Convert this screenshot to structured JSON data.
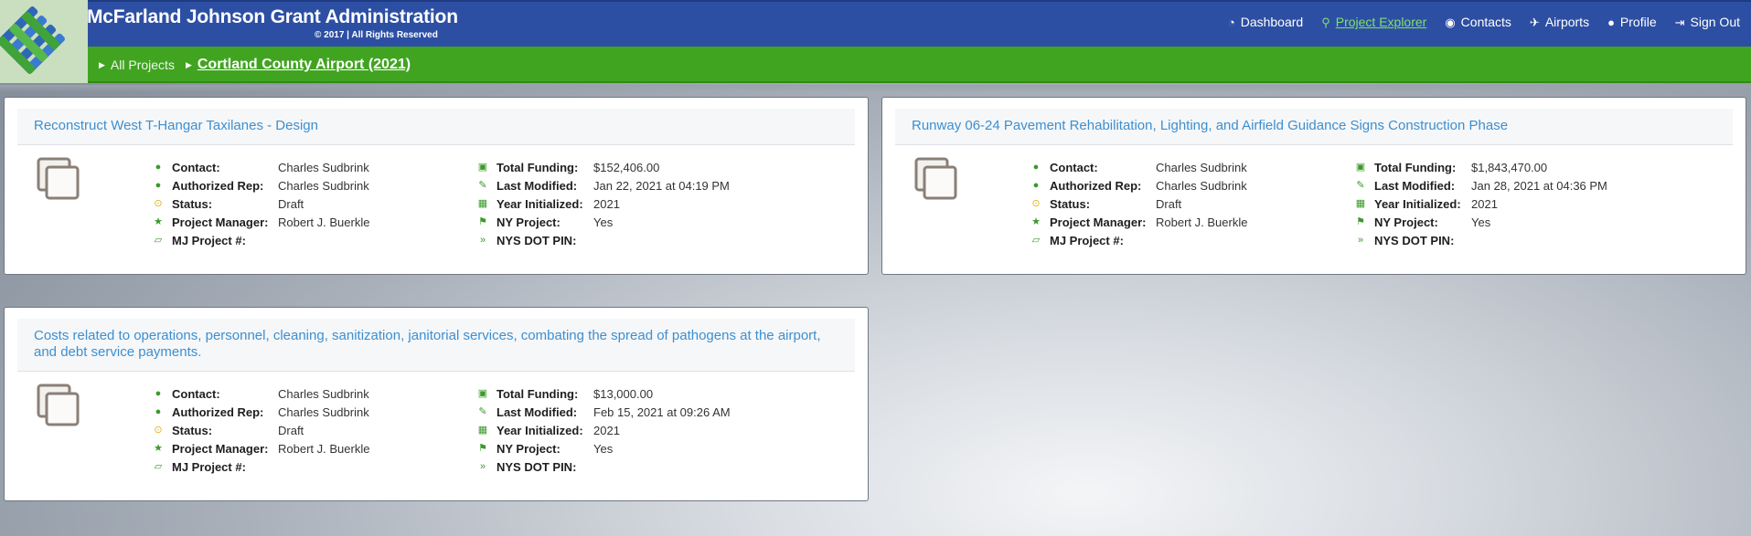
{
  "header": {
    "title": "McFarland Johnson Grant Administration",
    "copyright": "© 2017 | All Rights Reserved",
    "nav": [
      {
        "label": "Dashboard",
        "icon": "dashboard-icon",
        "glyph": "◔"
      },
      {
        "label": "Project Explorer",
        "icon": "search-icon",
        "glyph": "⚲"
      },
      {
        "label": "Contacts",
        "icon": "user-circle-icon",
        "glyph": "◉"
      },
      {
        "label": "Airports",
        "icon": "plane-icon",
        "glyph": "✈"
      },
      {
        "label": "Profile",
        "icon": "user-icon",
        "glyph": "●"
      },
      {
        "label": "Sign Out",
        "icon": "sign-out-icon",
        "glyph": "⇥"
      }
    ],
    "active_nav": "Project Explorer"
  },
  "breadcrumb": {
    "parent": "All Projects",
    "current": "Cortland County Airport (2021)"
  },
  "field_labels": {
    "contact": "Contact:",
    "authorized_rep": "Authorized Rep:",
    "status": "Status:",
    "project_manager": "Project Manager:",
    "mj_project": "MJ Project #:",
    "total_funding": "Total Funding:",
    "last_modified": "Last Modified:",
    "year_initialized": "Year Initialized:",
    "ny_project": "NY Project:",
    "nys_dot_pin": "NYS DOT PIN:"
  },
  "projects": [
    {
      "title": "Reconstruct West T-Hangar Taxilanes - Design",
      "contact": "Charles Sudbrink",
      "authorized_rep": "Charles Sudbrink",
      "status": "Draft",
      "project_manager": "Robert J. Buerkle",
      "mj_project": "",
      "total_funding": "$152,406.00",
      "last_modified": "Jan 22, 2021 at 04:19 PM",
      "year_initialized": "2021",
      "ny_project": "Yes",
      "nys_dot_pin": ""
    },
    {
      "title": "Runway 06-24 Pavement Rehabilitation, Lighting, and Airfield Guidance Signs Construction Phase",
      "contact": "Charles Sudbrink",
      "authorized_rep": "Charles Sudbrink",
      "status": "Draft",
      "project_manager": "Robert J. Buerkle",
      "mj_project": "",
      "total_funding": "$1,843,470.00",
      "last_modified": "Jan 28, 2021 at 04:36 PM",
      "year_initialized": "2021",
      "ny_project": "Yes",
      "nys_dot_pin": ""
    },
    {
      "title": "Costs related to operations, personnel, cleaning, sanitization, janitorial services, combating the spread of pathogens at the airport, and debt service payments.",
      "contact": "Charles Sudbrink",
      "authorized_rep": "Charles Sudbrink",
      "status": "Draft",
      "project_manager": "Robert J. Buerkle",
      "mj_project": "",
      "total_funding": "$13,000.00",
      "last_modified": "Feb 15, 2021 at 09:26 AM",
      "year_initialized": "2021",
      "ny_project": "Yes",
      "nys_dot_pin": ""
    }
  ],
  "colors": {
    "header_blue": "#2d4fa3",
    "breadcrumb_green": "#41a421",
    "active_nav_green": "#7ee06a",
    "link_blue": "#3d8fcf",
    "icon_green": "#3a9a2a",
    "status_yellow": "#e2b21c"
  }
}
